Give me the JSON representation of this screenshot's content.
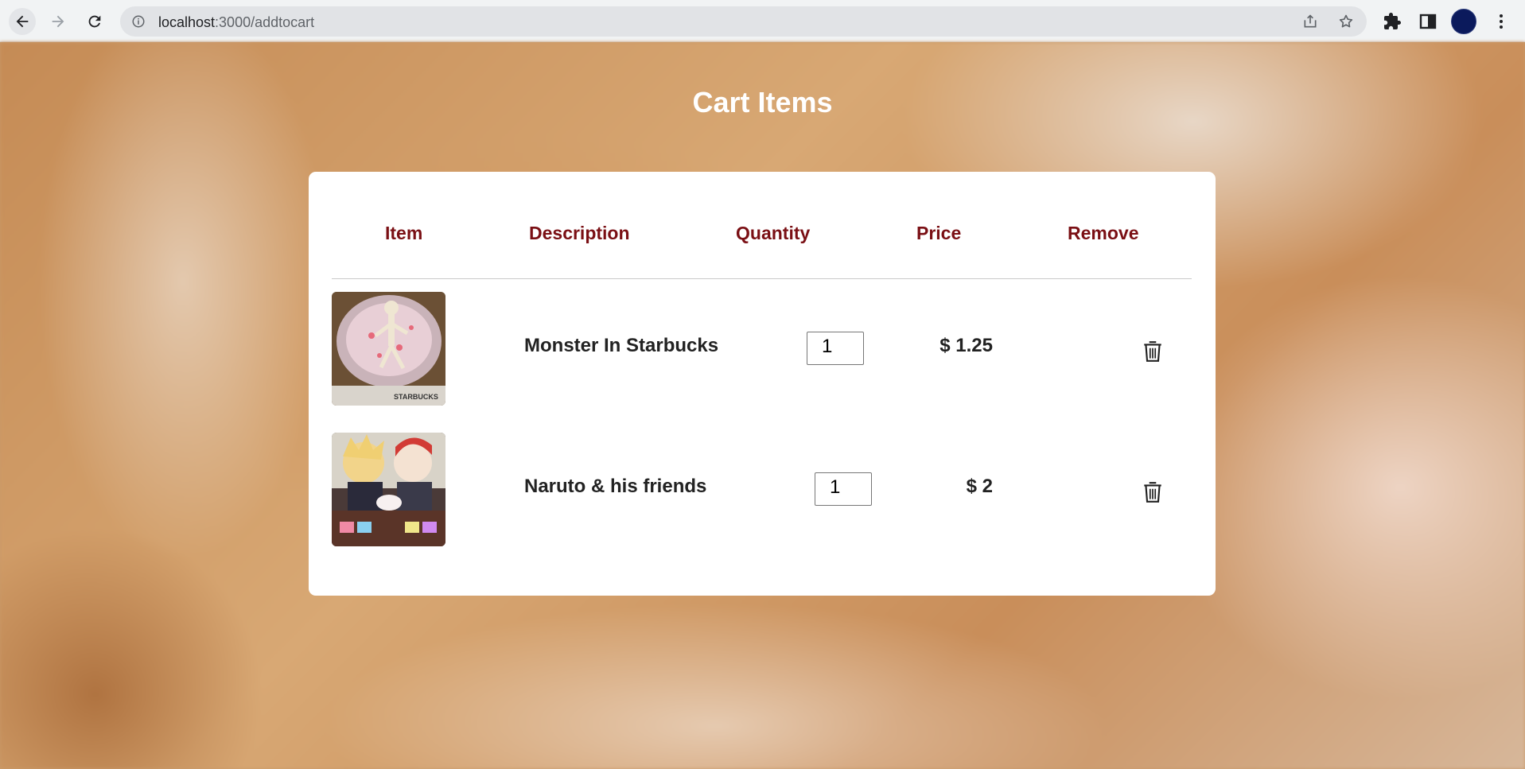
{
  "browser": {
    "url_host": "localhost",
    "url_path": ":3000/addtocart"
  },
  "page": {
    "title": "Cart Items"
  },
  "table": {
    "headers": [
      "Item",
      "Description",
      "Quantity",
      "Price",
      "Remove"
    ],
    "rows": [
      {
        "description": "Monster In Starbucks",
        "quantity": "1",
        "price": "$ 1.25",
        "image_caption": "STARBUCKS"
      },
      {
        "description": "Naruto & his friends",
        "quantity": "1",
        "price": "$ 2"
      }
    ]
  },
  "colors": {
    "header_text": "#7a0f14",
    "title_text": "#ffffff",
    "card_bg": "#ffffff"
  }
}
